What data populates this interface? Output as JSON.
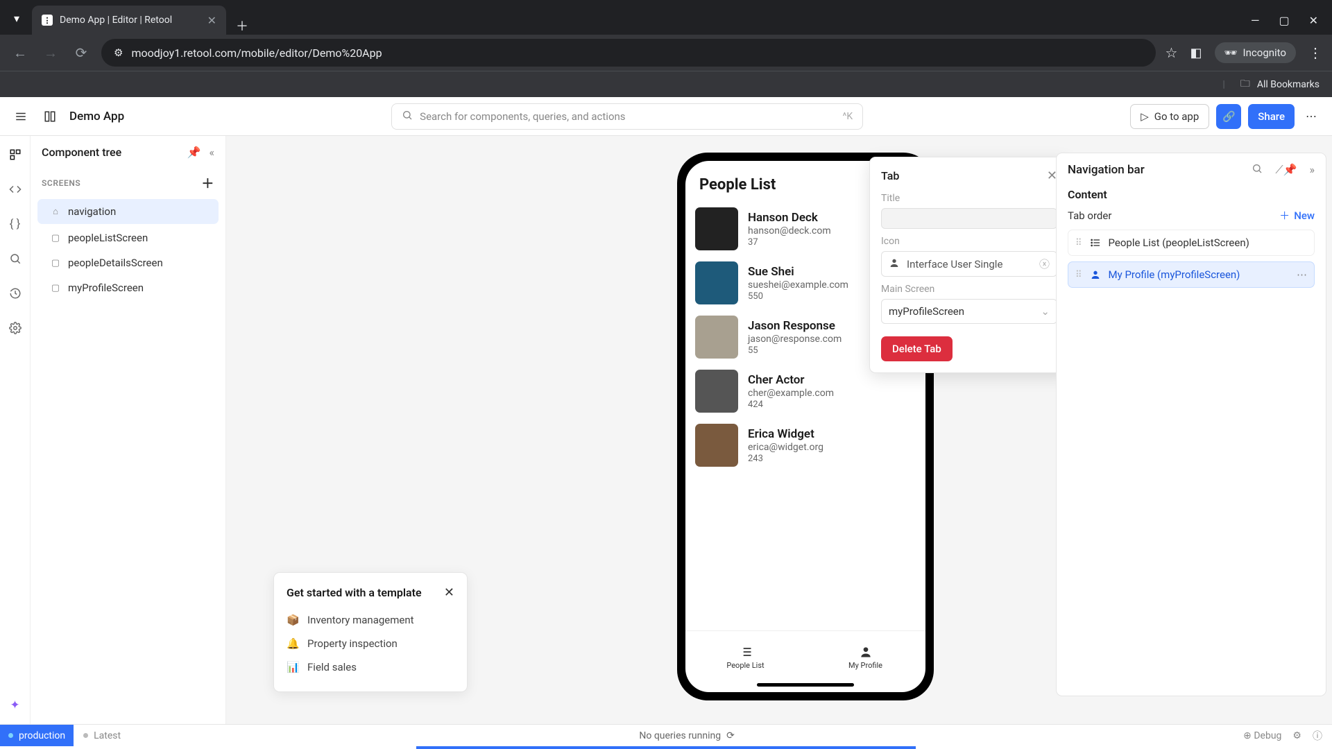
{
  "browser": {
    "tab_title": "Demo App | Editor | Retool",
    "url": "moodjoy1.retool.com/mobile/editor/Demo%20App",
    "incognito_label": "Incognito",
    "bookmarks_label": "All Bookmarks"
  },
  "app_header": {
    "title": "Demo App",
    "search_placeholder": "Search for components, queries, and actions",
    "search_shortcut": "^K",
    "go_to_app": "Go to app",
    "share": "Share"
  },
  "tree": {
    "panel_title": "Component tree",
    "screens_label": "SCREENS",
    "items": [
      {
        "label": "navigation",
        "selected": true
      },
      {
        "label": "peopleListScreen",
        "selected": false
      },
      {
        "label": "peopleDetailsScreen",
        "selected": false
      },
      {
        "label": "myProfileScreen",
        "selected": false
      }
    ]
  },
  "phone": {
    "header": "People List",
    "tabs": {
      "list": "People List",
      "profile": "My Profile"
    },
    "people": [
      {
        "name": "Hanson Deck",
        "email": "hanson@deck.com",
        "num": "37"
      },
      {
        "name": "Sue Shei",
        "email": "sueshei@example.com",
        "num": "550"
      },
      {
        "name": "Jason Response",
        "email": "jason@response.com",
        "num": "55"
      },
      {
        "name": "Cher Actor",
        "email": "cher@example.com",
        "num": "424"
      },
      {
        "name": "Erica Widget",
        "email": "erica@widget.org",
        "num": "243"
      }
    ]
  },
  "tab_popover": {
    "heading": "Tab",
    "title_label": "Title",
    "title_value": "",
    "icon_label": "Icon",
    "icon_value": "Interface User Single",
    "main_screen_label": "Main Screen",
    "main_screen_value": "myProfileScreen",
    "delete_label": "Delete Tab"
  },
  "inspector": {
    "title": "Navigation bar",
    "content_label": "Content",
    "tab_order_label": "Tab order",
    "new_label": "New",
    "items": [
      {
        "label": "People List (peopleListScreen)",
        "selected": false,
        "icon": "list"
      },
      {
        "label": "My Profile (myProfileScreen)",
        "selected": true,
        "icon": "user"
      }
    ]
  },
  "template_card": {
    "title": "Get started with a template",
    "items": [
      "Inventory management",
      "Property inspection",
      "Field sales"
    ]
  },
  "status": {
    "env": "production",
    "latest": "Latest",
    "center": "No queries running",
    "debug": "Debug"
  }
}
